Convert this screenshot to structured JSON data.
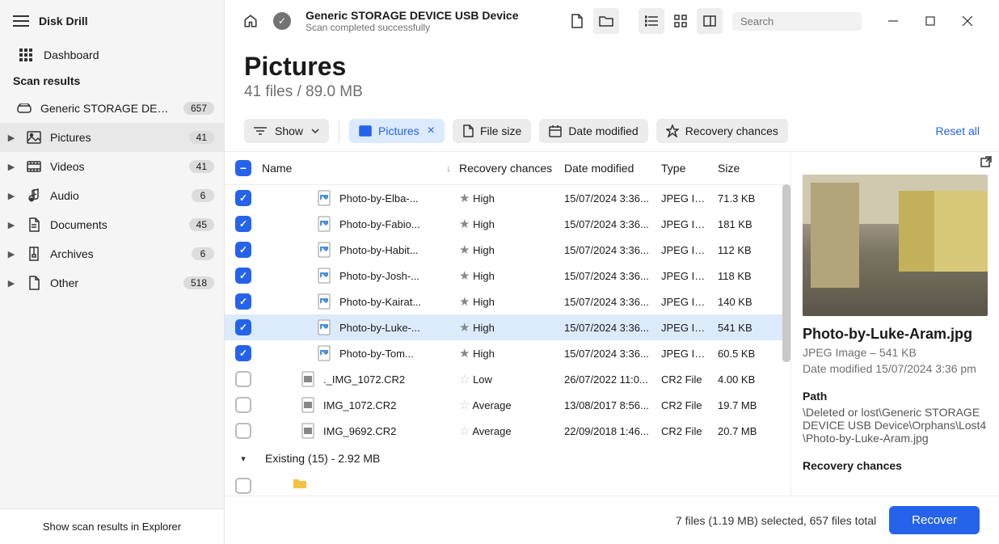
{
  "app_name": "Disk Drill",
  "sidebar": {
    "dashboard_label": "Dashboard",
    "scan_results_label": "Scan results",
    "device": {
      "label": "Generic STORAGE DEVIC...",
      "count": "657"
    },
    "categories": [
      {
        "label": "Pictures",
        "count": "41",
        "active": true,
        "icon": "picture"
      },
      {
        "label": "Videos",
        "count": "41",
        "icon": "video"
      },
      {
        "label": "Audio",
        "count": "6",
        "icon": "audio"
      },
      {
        "label": "Documents",
        "count": "45",
        "icon": "document"
      },
      {
        "label": "Archives",
        "count": "6",
        "icon": "archive"
      },
      {
        "label": "Other",
        "count": "518",
        "icon": "other"
      }
    ],
    "footer_link": "Show scan results in Explorer"
  },
  "header": {
    "title": "Generic STORAGE DEVICE USB Device",
    "subtitle": "Scan completed successfully"
  },
  "search_placeholder": "Search",
  "content": {
    "title": "Pictures",
    "subtitle": "41 files / 89.0 MB"
  },
  "filters": {
    "show_label": "Show",
    "pictures_label": "Pictures",
    "file_size_label": "File size",
    "date_modified_label": "Date modified",
    "recovery_chances_label": "Recovery chances",
    "reset_label": "Reset all"
  },
  "columns": {
    "name": "Name",
    "recovery_chances": "Recovery chances",
    "date_modified": "Date modified",
    "type": "Type",
    "size": "Size"
  },
  "rows": [
    {
      "checked": true,
      "indent": 60,
      "icon": "jpeg",
      "name": "Photo-by-Elba-...",
      "rc": "High",
      "star": "filled",
      "dm": "15/07/2024 3:36...",
      "type": "JPEG Im...",
      "size": "71.3 KB",
      "selected": false
    },
    {
      "checked": true,
      "indent": 60,
      "icon": "jpeg",
      "name": "Photo-by-Fabio...",
      "rc": "High",
      "star": "filled",
      "dm": "15/07/2024 3:36...",
      "type": "JPEG Im...",
      "size": "181 KB",
      "selected": false
    },
    {
      "checked": true,
      "indent": 60,
      "icon": "jpeg",
      "name": "Photo-by-Habit...",
      "rc": "High",
      "star": "filled",
      "dm": "15/07/2024 3:36...",
      "type": "JPEG Im...",
      "size": "112 KB",
      "selected": false
    },
    {
      "checked": true,
      "indent": 60,
      "icon": "jpeg",
      "name": "Photo-by-Josh-...",
      "rc": "High",
      "star": "filled",
      "dm": "15/07/2024 3:36...",
      "type": "JPEG Im...",
      "size": "118 KB",
      "selected": false
    },
    {
      "checked": true,
      "indent": 60,
      "icon": "jpeg",
      "name": "Photo-by-Kairat...",
      "rc": "High",
      "star": "filled",
      "dm": "15/07/2024 3:36...",
      "type": "JPEG Im...",
      "size": "140 KB",
      "selected": false
    },
    {
      "checked": true,
      "indent": 60,
      "icon": "jpeg",
      "name": "Photo-by-Luke-...",
      "rc": "High",
      "star": "filled",
      "dm": "15/07/2024 3:36...",
      "type": "JPEG Im...",
      "size": "541 KB",
      "selected": true
    },
    {
      "checked": true,
      "indent": 60,
      "icon": "jpeg",
      "name": "Photo-by-Tom...",
      "rc": "High",
      "star": "filled",
      "dm": "15/07/2024 3:36...",
      "type": "JPEG Im...",
      "size": "60.5 KB",
      "selected": false
    },
    {
      "checked": false,
      "indent": 40,
      "icon": "cr2",
      "name": "._IMG_1072.CR2",
      "rc": "Low",
      "star": "empty",
      "dm": "26/07/2022 11:0...",
      "type": "CR2 File",
      "size": "4.00 KB",
      "selected": false
    },
    {
      "checked": false,
      "indent": 40,
      "icon": "cr2",
      "name": "IMG_1072.CR2",
      "rc": "Average",
      "star": "empty",
      "dm": "13/08/2017 8:56...",
      "type": "CR2 File",
      "size": "19.7 MB",
      "selected": false
    },
    {
      "checked": false,
      "indent": 40,
      "icon": "cr2",
      "name": "IMG_9692.CR2",
      "rc": "Average",
      "star": "empty",
      "dm": "22/09/2018 1:46...",
      "type": "CR2 File",
      "size": "20.7 MB",
      "selected": false
    }
  ],
  "group_row": {
    "label": "Existing (15) - 2.92 MB"
  },
  "preview": {
    "filename": "Photo-by-Luke-Aram.jpg",
    "typeinfo": "JPEG Image – 541 KB",
    "date_label": "Date modified 15/07/2024 3:36 pm",
    "path_header": "Path",
    "path_value": "\\Deleted or lost\\Generic STORAGE DEVICE USB Device\\Orphans\\Lost4\\Photo-by-Luke-Aram.jpg",
    "rc_header": "Recovery chances"
  },
  "footer": {
    "status": "7 files (1.19 MB) selected, 657 files total",
    "recover_label": "Recover"
  }
}
